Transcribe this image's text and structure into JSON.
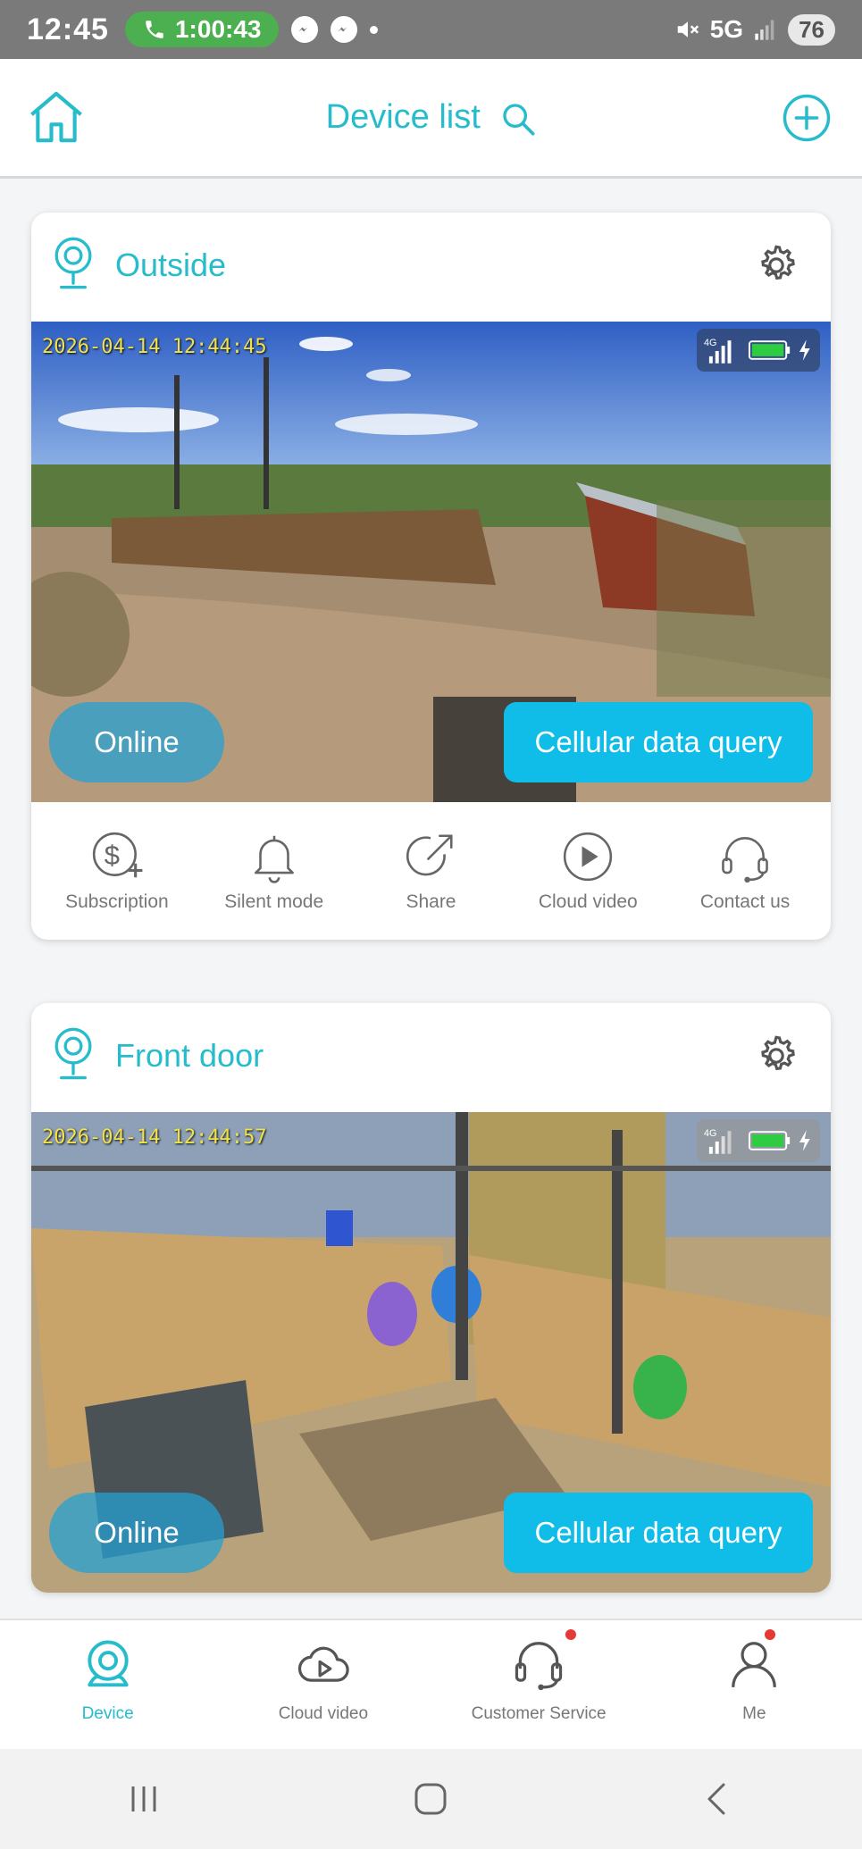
{
  "status_bar": {
    "time": "12:45",
    "call_timer": "1:00:43",
    "network": "5G",
    "battery": "76"
  },
  "header": {
    "title": "Device list"
  },
  "devices": [
    {
      "name": "Outside",
      "timestamp": "2026-04-14  12:44:45",
      "status": "Online",
      "data_button": "Cellular data query",
      "network_badge": "4G",
      "actions": [
        {
          "label": "Subscription",
          "icon": "subscription-dollar-icon"
        },
        {
          "label": "Silent mode",
          "icon": "bell-icon"
        },
        {
          "label": "Share",
          "icon": "share-icon"
        },
        {
          "label": "Cloud video",
          "icon": "play-circle-icon"
        },
        {
          "label": "Contact us",
          "icon": "headset-icon"
        }
      ]
    },
    {
      "name": "Front door",
      "timestamp": "2026-04-14  12:44:57",
      "status": "Online",
      "data_button": "Cellular data query",
      "network_badge": "4G"
    }
  ],
  "bottom_nav": [
    {
      "label": "Device",
      "active": true
    },
    {
      "label": "Cloud video",
      "active": false
    },
    {
      "label": "Customer Service",
      "active": false,
      "badge": true
    },
    {
      "label": "Me",
      "active": false,
      "badge": true
    }
  ],
  "colors": {
    "accent": "#26bccb",
    "data_button": "#10bde8",
    "status_bar": "#7a7a7a"
  }
}
